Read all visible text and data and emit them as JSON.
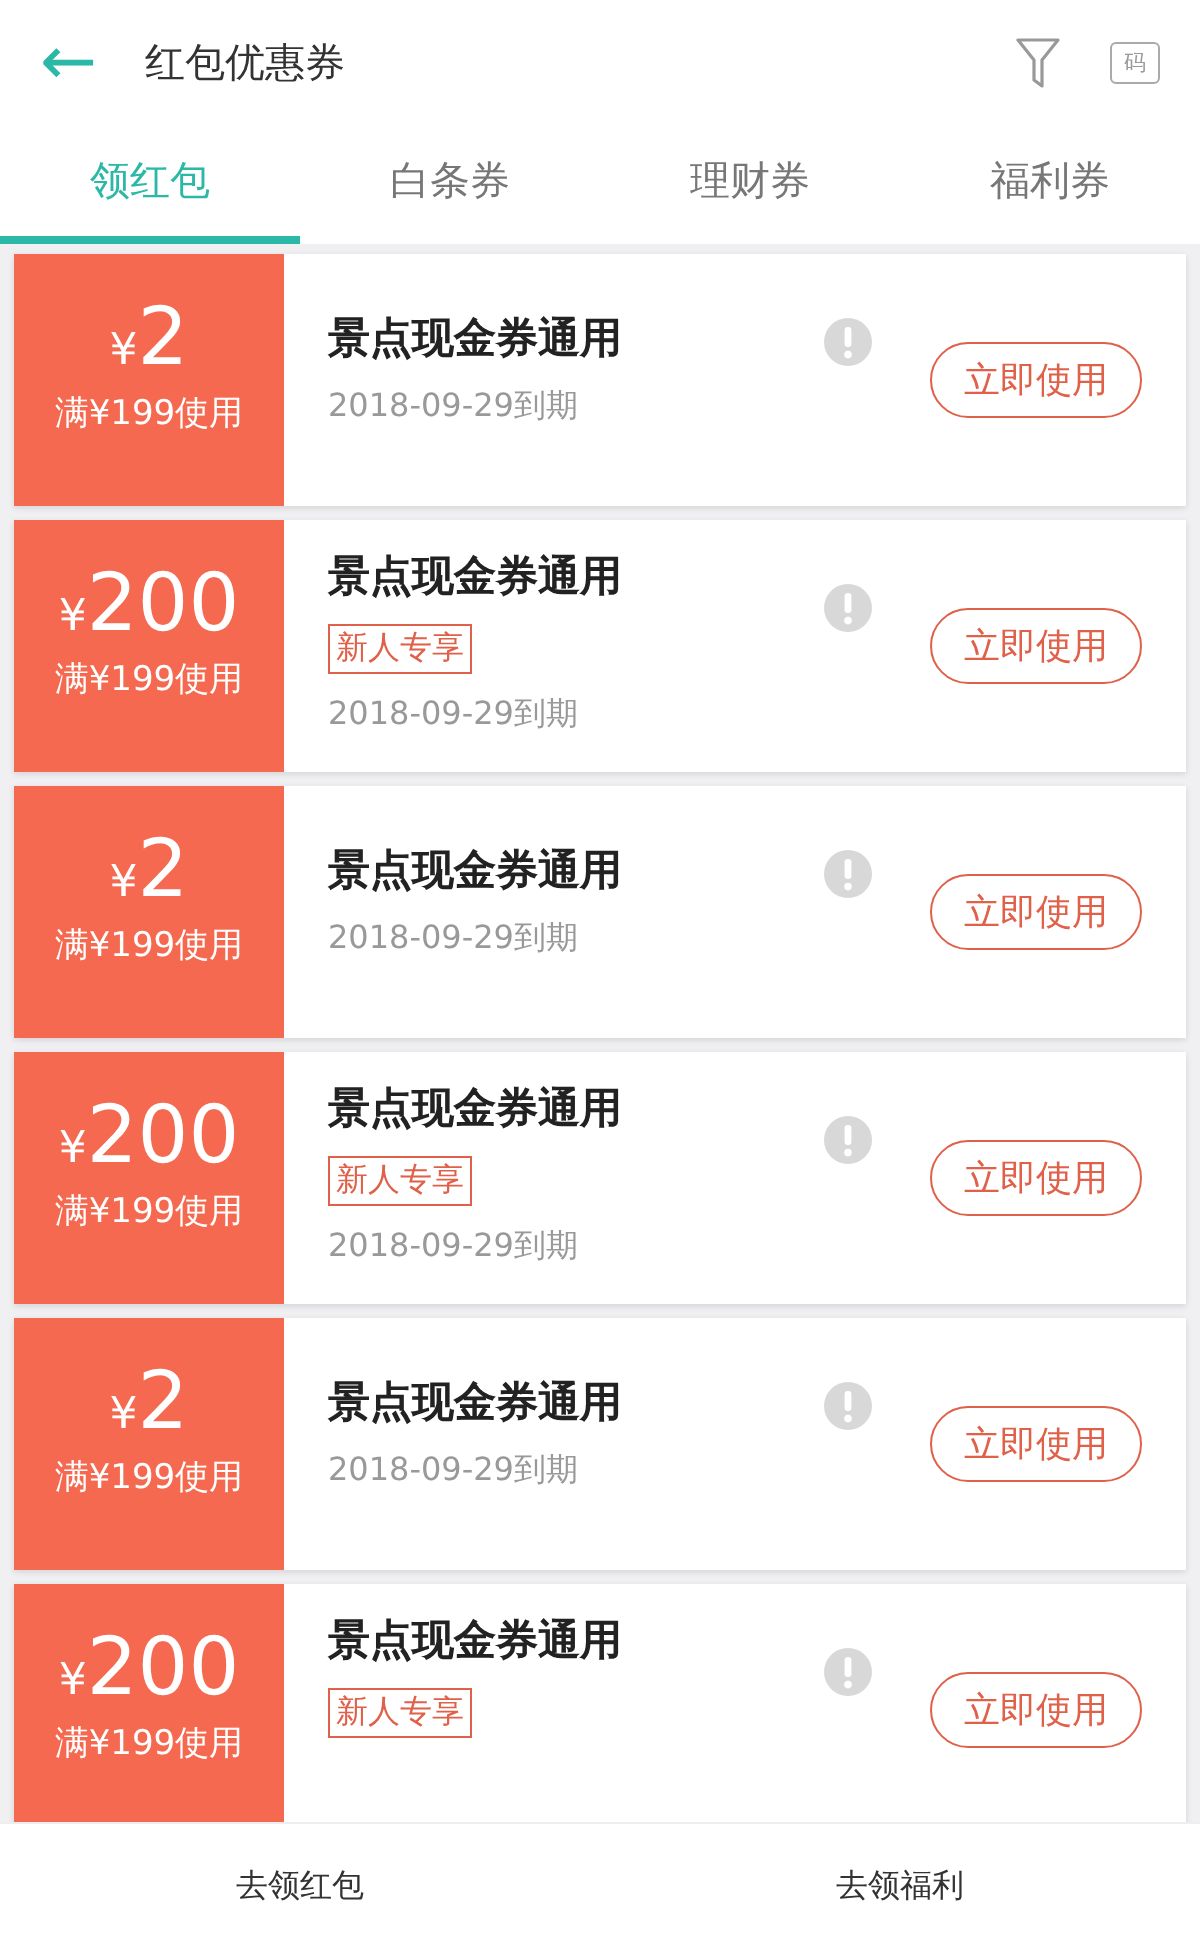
{
  "header": {
    "back": "←",
    "title": "红包优惠券",
    "ticket_label": "码"
  },
  "tabs": [
    {
      "label": "领红包",
      "selected": true
    },
    {
      "label": "白条券",
      "selected": false
    },
    {
      "label": "理财券",
      "selected": false
    },
    {
      "label": "福利券",
      "selected": false
    }
  ],
  "coupons": [
    {
      "currency": "¥",
      "amount": "2",
      "condition": "满¥199使用",
      "title": "景点现金券通用",
      "date": "2018-09-29到期",
      "button": "立即使用"
    },
    {
      "currency": "¥",
      "amount": "200",
      "condition": "满¥199使用",
      "title": "景点现金券通用",
      "tag": "新人专享",
      "date": "2018-09-29到期",
      "button": "立即使用"
    },
    {
      "currency": "¥",
      "amount": "2",
      "condition": "满¥199使用",
      "title": "景点现金券通用",
      "date": "2018-09-29到期",
      "button": "立即使用"
    },
    {
      "currency": "¥",
      "amount": "200",
      "condition": "满¥199使用",
      "title": "景点现金券通用",
      "tag": "新人专享",
      "date": "2018-09-29到期",
      "button": "立即使用"
    },
    {
      "currency": "¥",
      "amount": "2",
      "condition": "满¥199使用",
      "title": "景点现金券通用",
      "date": "2018-09-29到期",
      "button": "立即使用"
    },
    {
      "currency": "¥",
      "amount": "200",
      "condition": "满¥199使用",
      "title": "景点现金券通用",
      "tag": "新人专享",
      "button": "立即使用"
    }
  ],
  "bottom_bar": [
    "去领红包",
    "去领福利"
  ]
}
